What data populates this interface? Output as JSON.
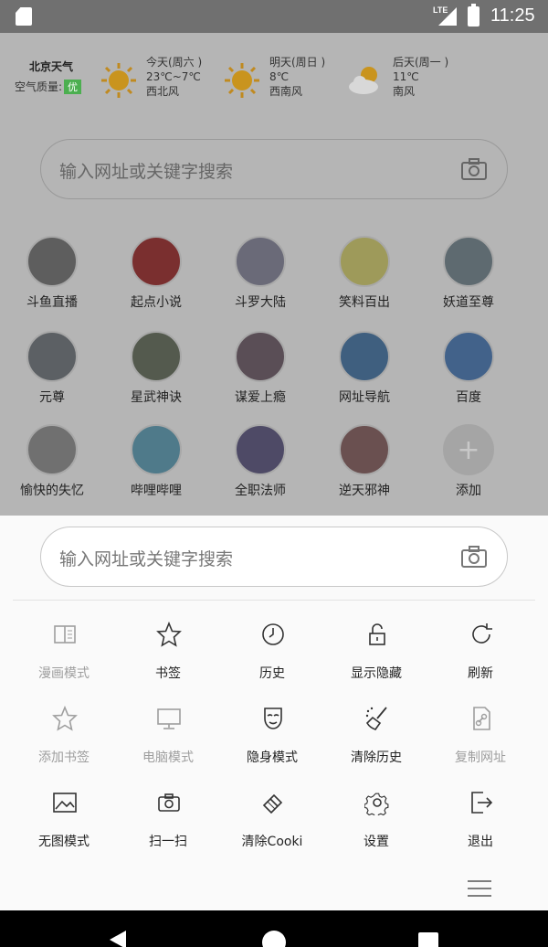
{
  "status_bar": {
    "network": "LTE",
    "time": "11:25"
  },
  "weather": {
    "city": "北京天气",
    "air_quality_label": "空气质量:",
    "air_quality_value": "优",
    "days": [
      {
        "day": "今天(周六 )",
        "temp": "23℃~7℃",
        "wind": "西北风",
        "icon": "sun-icon"
      },
      {
        "day": "明天(周日 )",
        "temp": "8℃",
        "wind": "西南风",
        "icon": "sun-icon"
      },
      {
        "day": "后天(周一 )",
        "temp": "11℃",
        "wind": "南风",
        "icon": "cloudy-icon"
      }
    ]
  },
  "search": {
    "placeholder": "输入网址或关键字搜索"
  },
  "shortcuts": [
    {
      "label": "斗鱼直播",
      "icon": "douyu-icon",
      "color": "#5e5e5e"
    },
    {
      "label": "起点小说",
      "icon": "qidian-icon",
      "color": "#7a2f2f"
    },
    {
      "label": "斗罗大陆",
      "icon": "douluo-icon",
      "color": "#6a6a78"
    },
    {
      "label": "笑料百出",
      "icon": "smiley-icon",
      "color": "#9e9a5a"
    },
    {
      "label": "妖道至尊",
      "icon": "yaodao-icon",
      "color": "#5e6a70"
    },
    {
      "label": "元尊",
      "icon": "yuanzun-icon",
      "color": "#5c6064"
    },
    {
      "label": "星武神诀",
      "icon": "xingwu-icon",
      "color": "#545a4e"
    },
    {
      "label": "谋爱上瘾",
      "icon": "mouai-icon",
      "color": "#5a4e56"
    },
    {
      "label": "网址导航",
      "icon": "compass-icon",
      "color": "#3f5f7f"
    },
    {
      "label": "百度",
      "icon": "baidu-icon",
      "color": "#42628a"
    },
    {
      "label": "愉快的失忆",
      "icon": "yukuai-icon",
      "color": "#707070"
    },
    {
      "label": "哔哩哔哩",
      "icon": "bilibili-icon",
      "color": "#4f7a8a"
    },
    {
      "label": "全职法师",
      "icon": "quanzhi-icon",
      "color": "#4e4a66"
    },
    {
      "label": "逆天邪神",
      "icon": "nitian-icon",
      "color": "#6a5050"
    },
    {
      "label": "添加",
      "icon": "add-icon",
      "color": "#a5a5a5"
    }
  ],
  "menu": {
    "items": [
      {
        "label": "漫画模式",
        "icon": "comic-mode-icon",
        "enabled": false
      },
      {
        "label": "书签",
        "icon": "star-icon",
        "enabled": true
      },
      {
        "label": "历史",
        "icon": "clock-icon",
        "enabled": true
      },
      {
        "label": "显示隐藏",
        "icon": "unlock-icon",
        "enabled": true
      },
      {
        "label": "刷新",
        "icon": "refresh-icon",
        "enabled": true
      },
      {
        "label": "添加书签",
        "icon": "star-outline-icon",
        "enabled": false
      },
      {
        "label": "电脑模式",
        "icon": "monitor-icon",
        "enabled": false
      },
      {
        "label": "隐身模式",
        "icon": "mask-icon",
        "enabled": true
      },
      {
        "label": "清除历史",
        "icon": "broom-icon",
        "enabled": true
      },
      {
        "label": "复制网址",
        "icon": "copy-link-icon",
        "enabled": false
      },
      {
        "label": "无图模式",
        "icon": "image-icon",
        "enabled": true
      },
      {
        "label": "扫一扫",
        "icon": "camera-icon",
        "enabled": true
      },
      {
        "label": "清除Cooki",
        "icon": "eraser-icon",
        "enabled": true
      },
      {
        "label": "设置",
        "icon": "gear-icon",
        "enabled": true
      },
      {
        "label": "退出",
        "icon": "exit-icon",
        "enabled": true
      }
    ]
  }
}
